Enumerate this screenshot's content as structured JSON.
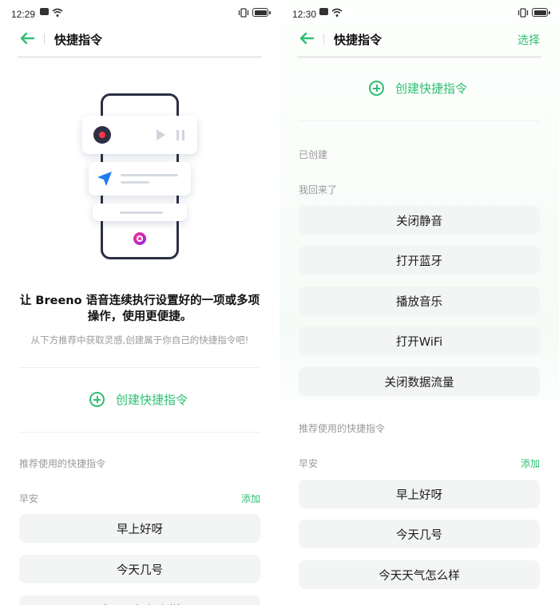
{
  "left": {
    "status": {
      "time": "12:29"
    },
    "header": {
      "title": "快捷指令"
    },
    "headline": "让 Breeno 语音连续执行设置好的一项或多项操作，使用更便捷。",
    "subline": "从下方推荐中获取灵感,创建属于你自己的快捷指令吧!",
    "create_label": "创建快捷指令",
    "recommended_label": "推荐使用的快捷指令",
    "group": {
      "name": "早安",
      "add_label": "添加",
      "items": [
        "早上好呀",
        "今天几号",
        "今天天气怎么样"
      ]
    }
  },
  "right": {
    "status": {
      "time": "12:30"
    },
    "header": {
      "title": "快捷指令",
      "select_label": "选择"
    },
    "create_label": "创建快捷指令",
    "created_label": "已创建",
    "created_group": {
      "name": "我回来了",
      "items": [
        "关闭静音",
        "打开蓝牙",
        "播放音乐",
        "打开WiFi",
        "关闭数据流量"
      ]
    },
    "recommended_label": "推荐使用的快捷指令",
    "group": {
      "name": "早安",
      "add_label": "添加",
      "items": [
        "早上好呀",
        "今天几号",
        "今天天气怎么样"
      ]
    }
  },
  "colors": {
    "accent": "#2fbf71",
    "pill_bg": "#f3f5f4",
    "muted_text": "#9a9a9a"
  },
  "icons": [
    "back-arrow-icon",
    "add-circle-icon",
    "message-icon",
    "wifi-icon",
    "vibrate-icon",
    "battery-icon"
  ]
}
